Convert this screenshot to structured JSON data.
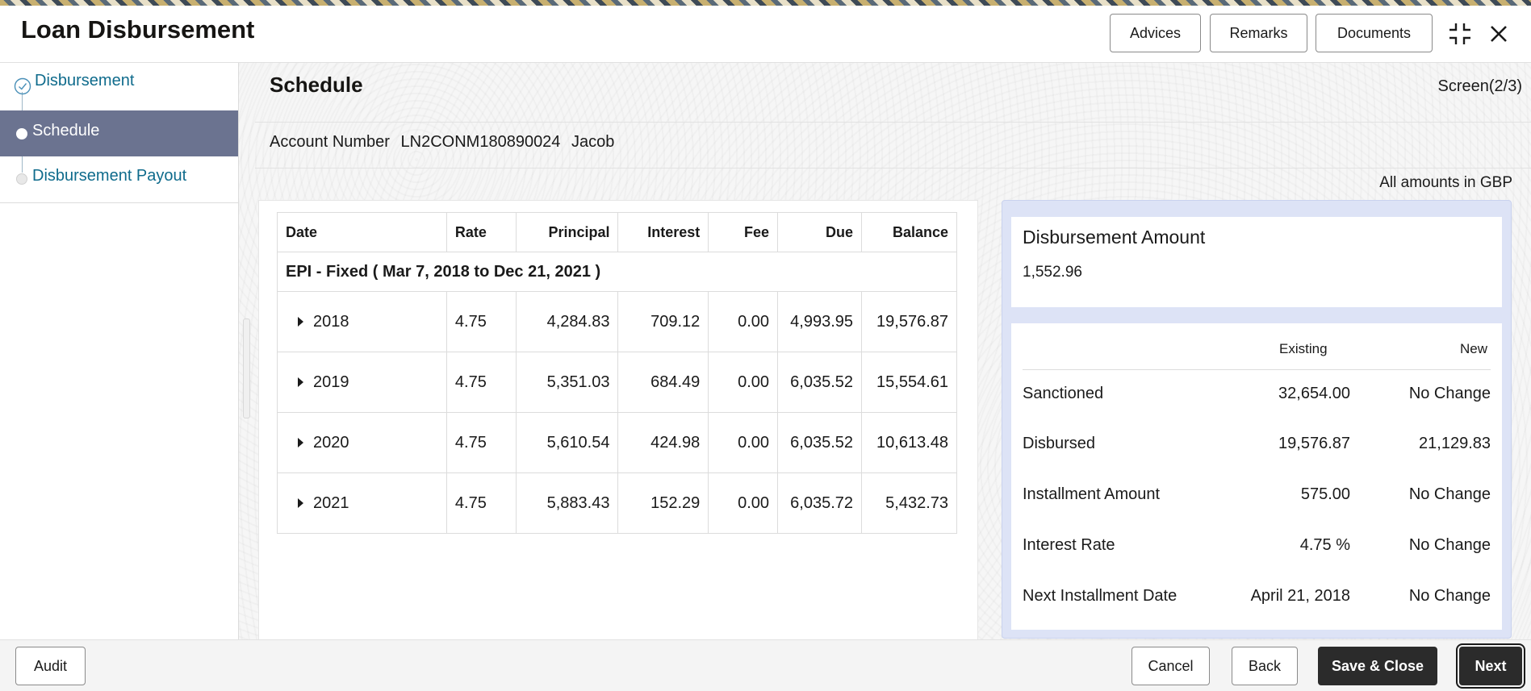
{
  "header": {
    "title": "Loan Disbursement",
    "buttons": {
      "advices": "Advices",
      "remarks": "Remarks",
      "documents": "Documents"
    },
    "icons": {
      "maximize": "maximize-icon",
      "close": "close-icon"
    }
  },
  "sidebar": {
    "steps": [
      {
        "label": "Disbursement",
        "state": "completed"
      },
      {
        "label": "Schedule",
        "state": "active"
      },
      {
        "label": "Disbursement Payout",
        "state": "pending"
      }
    ]
  },
  "main": {
    "title": "Schedule",
    "screen_indicator": "Screen(2/3)",
    "account": {
      "label": "Account Number",
      "number": "LN2CONM180890024",
      "name": "Jacob"
    },
    "currency_note": "All amounts in GBP",
    "schedule": {
      "columns": [
        "Date",
        "Rate",
        "Principal",
        "Interest",
        "Fee",
        "Due",
        "Balance"
      ],
      "group_label": "EPI - Fixed ( Mar 7, 2018 to Dec 21, 2021 )",
      "rows": [
        {
          "date": "2018",
          "rate": "4.75",
          "principal": "4,284.83",
          "interest": "709.12",
          "fee": "0.00",
          "due": "4,993.95",
          "balance": "19,576.87"
        },
        {
          "date": "2019",
          "rate": "4.75",
          "principal": "5,351.03",
          "interest": "684.49",
          "fee": "0.00",
          "due": "6,035.52",
          "balance": "15,554.61"
        },
        {
          "date": "2020",
          "rate": "4.75",
          "principal": "5,610.54",
          "interest": "424.98",
          "fee": "0.00",
          "due": "6,035.52",
          "balance": "10,613.48"
        },
        {
          "date": "2021",
          "rate": "4.75",
          "principal": "5,883.43",
          "interest": "152.29",
          "fee": "0.00",
          "due": "6,035.72",
          "balance": "5,432.73"
        }
      ]
    },
    "summary": {
      "disbursement_label": "Disbursement Amount",
      "disbursement_value": "1,552.96",
      "headers": {
        "existing": "Existing",
        "new": "New"
      },
      "rows": [
        {
          "label": "Sanctioned",
          "existing": "32,654.00",
          "new": "No Change"
        },
        {
          "label": "Disbursed",
          "existing": "19,576.87",
          "new": "21,129.83"
        },
        {
          "label": "Installment Amount",
          "existing": "575.00",
          "new": "No Change"
        },
        {
          "label": "Interest Rate",
          "existing": "4.75 %",
          "new": "No Change"
        },
        {
          "label": "Next Installment Date",
          "existing": "April 21, 2018",
          "new": "No Change"
        }
      ]
    }
  },
  "footer": {
    "audit": "Audit",
    "cancel": "Cancel",
    "back": "Back",
    "save_close": "Save & Close",
    "next": "Next"
  },
  "colors": {
    "sidebar_active": "#6b7390",
    "link": "#0f6b8c",
    "summary_panel": "#dde3f6",
    "primary_button": "#2b2b2b"
  }
}
